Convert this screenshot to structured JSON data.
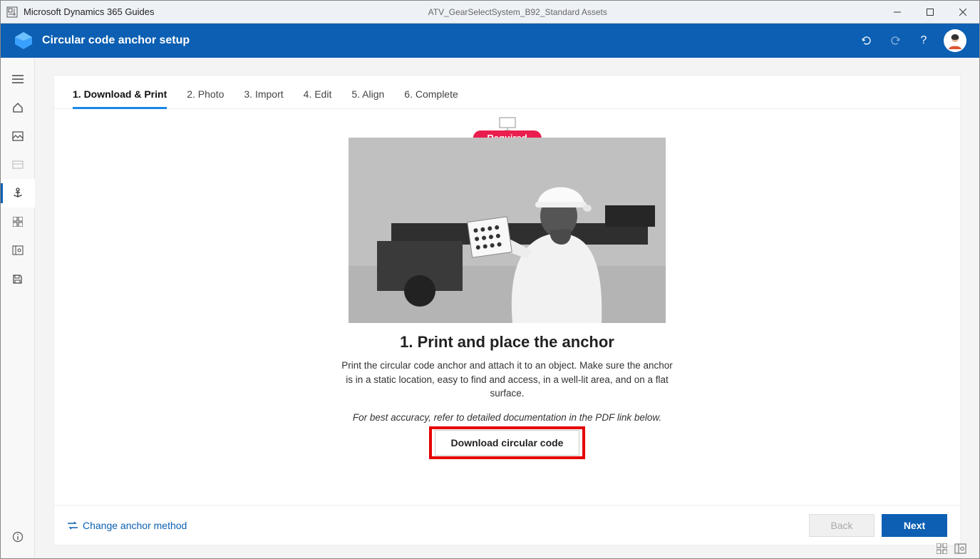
{
  "titlebar": {
    "app_name": "Microsoft Dynamics 365 Guides",
    "document": "ATV_GearSelectSystem_B92_Standard Assets"
  },
  "header": {
    "title": "Circular code anchor setup"
  },
  "tabs": [
    {
      "label": "1. Download & Print",
      "active": true
    },
    {
      "label": "2. Photo",
      "active": false
    },
    {
      "label": "3. Import",
      "active": false
    },
    {
      "label": "4. Edit",
      "active": false
    },
    {
      "label": "5. Align",
      "active": false
    },
    {
      "label": "6. Complete",
      "active": false
    }
  ],
  "content": {
    "badge": "Required",
    "step_title": "1. Print and place the anchor",
    "step_description": "Print the circular code anchor and attach it to an object. Make sure the anchor is in a static location, easy to find and access, in a well-lit area, and on a flat surface.",
    "step_note": "For best accuracy, refer to detailed documentation in the PDF link below.",
    "download_button": "Download circular code"
  },
  "footer": {
    "change_link": "Change anchor method",
    "back": "Back",
    "next": "Next"
  }
}
